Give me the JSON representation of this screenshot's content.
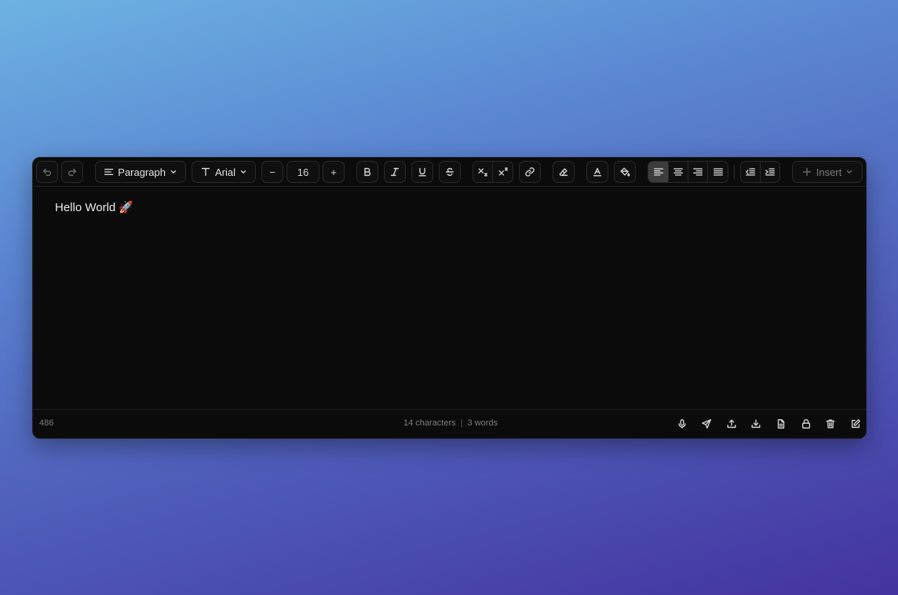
{
  "toolbar": {
    "undo_icon": "undo-icon",
    "redo_icon": "redo-icon",
    "block_type": "Paragraph",
    "font_family": "Arial",
    "font_size": "16",
    "decrease": "−",
    "increase": "+",
    "insert_label": "Insert",
    "active_alignment": "left"
  },
  "editor": {
    "content": "Hello World 🚀"
  },
  "status": {
    "position": "486",
    "characters": "14 characters",
    "separator": "|",
    "words": "3 words"
  },
  "colors": {
    "background_top": "#6db3e2",
    "background_bottom": "#4433a0",
    "editor_bg": "#0b0b0b",
    "active_button": "#3d3d3d"
  }
}
